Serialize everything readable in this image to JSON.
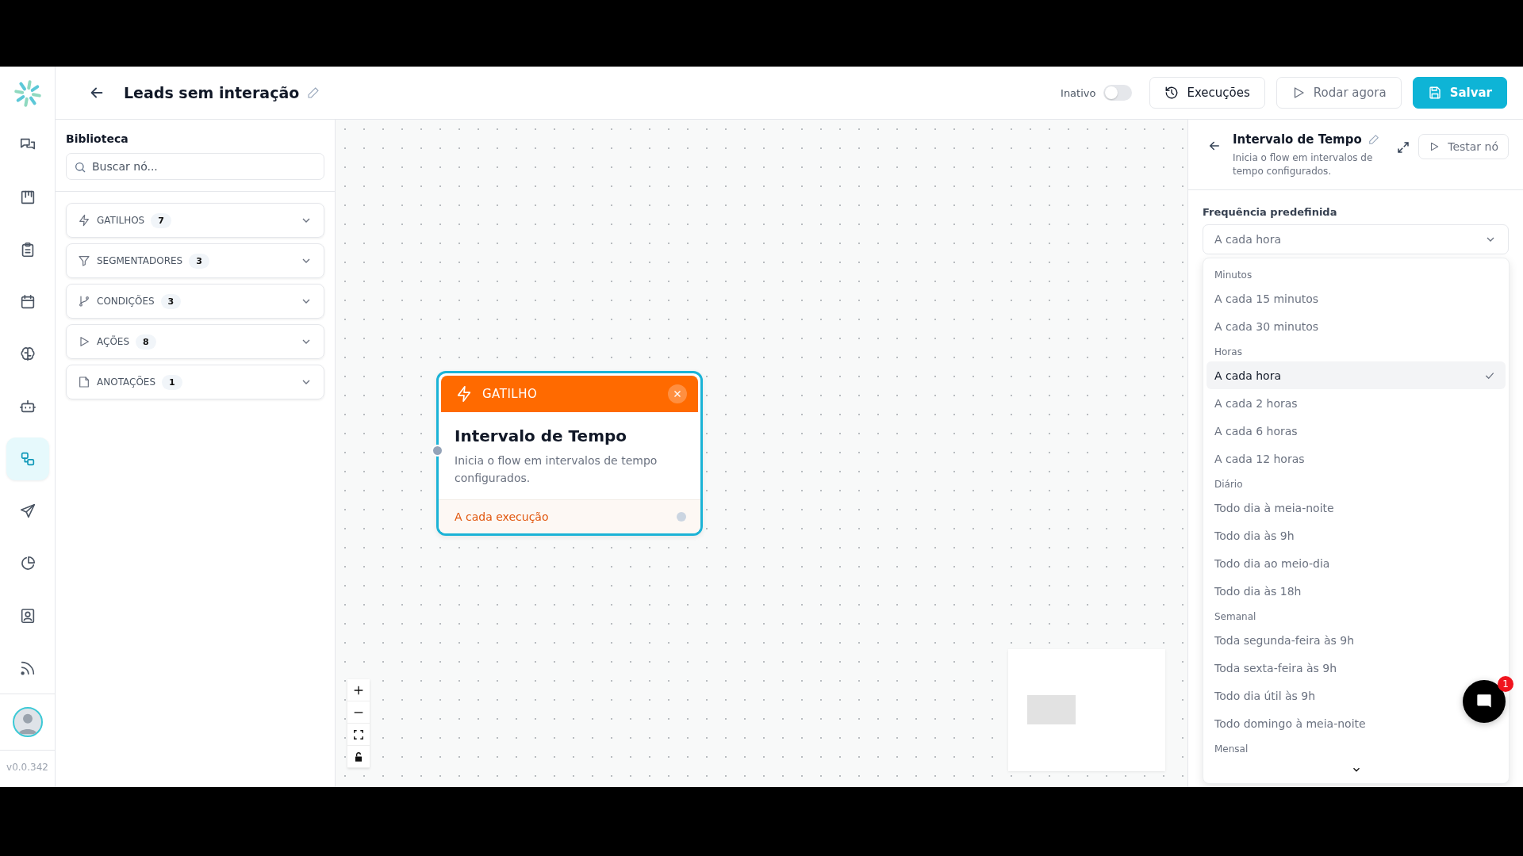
{
  "header": {
    "title": "Leads sem interação",
    "status_label": "Inativo",
    "active": false,
    "buttons": [
      {
        "kind": "history",
        "label": "Execuções"
      },
      {
        "kind": "run",
        "label": "Rodar agora"
      },
      {
        "kind": "save",
        "label": "Salvar"
      }
    ]
  },
  "nav": {
    "items": [
      {
        "kind": "chat",
        "selected": false
      },
      {
        "kind": "board",
        "selected": false
      },
      {
        "kind": "clipboard",
        "selected": false
      },
      {
        "kind": "calendar",
        "selected": false
      },
      {
        "kind": "brain",
        "selected": false
      },
      {
        "kind": "robot",
        "selected": false
      },
      {
        "kind": "flow",
        "selected": true
      },
      {
        "kind": "send",
        "selected": false
      },
      {
        "kind": "pie",
        "selected": false
      },
      {
        "kind": "contact",
        "selected": false
      },
      {
        "kind": "feed",
        "selected": false
      }
    ],
    "version": "v0.0.342"
  },
  "library": {
    "title": "Biblioteca",
    "search": {
      "placeholder": "Buscar nó..."
    },
    "categories": [
      {
        "kind": "trigger",
        "label": "GATILHOS",
        "count": "7"
      },
      {
        "kind": "filter",
        "label": "SEGMENTADORES",
        "count": "3"
      },
      {
        "kind": "branch",
        "label": "CONDIÇÕES",
        "count": "3"
      },
      {
        "kind": "play",
        "label": "AÇÕES",
        "count": "8"
      },
      {
        "kind": "note",
        "label": "ANOTAÇÕES",
        "count": "1"
      }
    ]
  },
  "canvas": {
    "node": {
      "type_label": "GATILHO",
      "title": "Intervalo de Tempo",
      "description": "Inicia o flow em intervalos de tempo configurados.",
      "output": "A cada execução"
    }
  },
  "panel": {
    "title": "Intervalo de Tempo",
    "description": "Inicia o flow em intervalos de tempo configurados.",
    "test_button": "Testar nó",
    "field_label": "Frequência predefinida",
    "field_value": "A cada hora",
    "groups": [
      {
        "label": "Minutos",
        "options": [
          {
            "label": "A cada 15 minutos",
            "selected": false
          },
          {
            "label": "A cada 30 minutos",
            "selected": false
          }
        ]
      },
      {
        "label": "Horas",
        "options": [
          {
            "label": "A cada hora",
            "selected": true
          },
          {
            "label": "A cada 2 horas",
            "selected": false
          },
          {
            "label": "A cada 6 horas",
            "selected": false
          },
          {
            "label": "A cada 12 horas",
            "selected": false
          }
        ]
      },
      {
        "label": "Diário",
        "options": [
          {
            "label": "Todo dia à meia-noite",
            "selected": false
          },
          {
            "label": "Todo dia às 9h",
            "selected": false
          },
          {
            "label": "Todo dia ao meio-dia",
            "selected": false
          },
          {
            "label": "Todo dia às 18h",
            "selected": false
          }
        ]
      },
      {
        "label": "Semanal",
        "options": [
          {
            "label": "Toda segunda-feira às 9h",
            "selected": false
          },
          {
            "label": "Toda sexta-feira às 9h",
            "selected": false
          },
          {
            "label": "Todo dia útil às 9h",
            "selected": false
          },
          {
            "label": "Todo domingo à meia-noite",
            "selected": false
          }
        ]
      },
      {
        "label": "Mensal"
      }
    ]
  },
  "chat": {
    "badge": "1"
  }
}
